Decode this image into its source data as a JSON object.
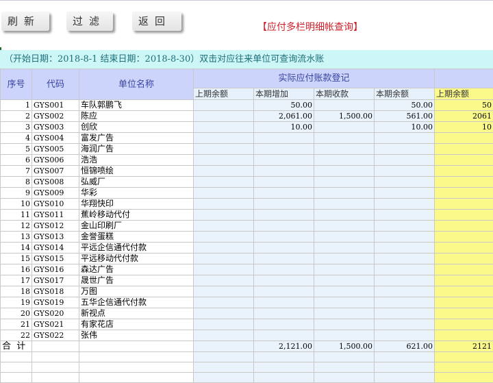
{
  "toolbar": {
    "refresh": "刷新",
    "filter": "过滤",
    "back": "返回"
  },
  "page_title": "【应付多栏明细帐查询】",
  "info_bar": "（开始日期：2018-8-1  结束日期：2018-8-30）双击对应往来单位可查询流水账",
  "headers": {
    "seq": "序号",
    "code": "代码",
    "name": "单位名称",
    "group": "实际应付账款登记",
    "prev_balance": "上期余额",
    "increase": "本期增加",
    "received": "本期收款",
    "cur_balance": "本期余额",
    "prev_balance2": "上期余额"
  },
  "rows": [
    {
      "seq": "1",
      "code": "GYS001",
      "name": "车队郭鹏飞",
      "prev": "",
      "inc": "50.00",
      "rec": "",
      "bal": "50.00",
      "prev2": "50"
    },
    {
      "seq": "2",
      "code": "GYS002",
      "name": "陈应",
      "prev": "",
      "inc": "2,061.00",
      "rec": "1,500.00",
      "bal": "561.00",
      "prev2": "2061"
    },
    {
      "seq": "3",
      "code": "GYS003",
      "name": "创欣",
      "prev": "",
      "inc": "10.00",
      "rec": "",
      "bal": "10.00",
      "prev2": "10"
    },
    {
      "seq": "4",
      "code": "GYS004",
      "name": "富发广告",
      "prev": "",
      "inc": "",
      "rec": "",
      "bal": "",
      "prev2": ""
    },
    {
      "seq": "5",
      "code": "GYS005",
      "name": "海润广告",
      "prev": "",
      "inc": "",
      "rec": "",
      "bal": "",
      "prev2": ""
    },
    {
      "seq": "6",
      "code": "GYS006",
      "name": "浩浩",
      "prev": "",
      "inc": "",
      "rec": "",
      "bal": "",
      "prev2": ""
    },
    {
      "seq": "7",
      "code": "GYS007",
      "name": "恒锦喷绘",
      "prev": "",
      "inc": "",
      "rec": "",
      "bal": "",
      "prev2": ""
    },
    {
      "seq": "8",
      "code": "GYS008",
      "name": "弘威厂",
      "prev": "",
      "inc": "",
      "rec": "",
      "bal": "",
      "prev2": ""
    },
    {
      "seq": "9",
      "code": "GYS009",
      "name": "华彩",
      "prev": "",
      "inc": "",
      "rec": "",
      "bal": "",
      "prev2": ""
    },
    {
      "seq": "10",
      "code": "GYS010",
      "name": "华翔快印",
      "prev": "",
      "inc": "",
      "rec": "",
      "bal": "",
      "prev2": ""
    },
    {
      "seq": "11",
      "code": "GYS011",
      "name": "蕉岭移动代付",
      "prev": "",
      "inc": "",
      "rec": "",
      "bal": "",
      "prev2": ""
    },
    {
      "seq": "12",
      "code": "GYS012",
      "name": "金山印刷厂",
      "prev": "",
      "inc": "",
      "rec": "",
      "bal": "",
      "prev2": ""
    },
    {
      "seq": "13",
      "code": "GYS013",
      "name": "金誉蛋糕",
      "prev": "",
      "inc": "",
      "rec": "",
      "bal": "",
      "prev2": ""
    },
    {
      "seq": "14",
      "code": "GYS014",
      "name": "平远企信通代付款",
      "prev": "",
      "inc": "",
      "rec": "",
      "bal": "",
      "prev2": ""
    },
    {
      "seq": "15",
      "code": "GYS015",
      "name": "平远移动代付款",
      "prev": "",
      "inc": "",
      "rec": "",
      "bal": "",
      "prev2": ""
    },
    {
      "seq": "16",
      "code": "GYS016",
      "name": "森达广告",
      "prev": "",
      "inc": "",
      "rec": "",
      "bal": "",
      "prev2": ""
    },
    {
      "seq": "17",
      "code": "GYS017",
      "name": "晟世广告",
      "prev": "",
      "inc": "",
      "rec": "",
      "bal": "",
      "prev2": ""
    },
    {
      "seq": "18",
      "code": "GYS018",
      "name": "万图",
      "prev": "",
      "inc": "",
      "rec": "",
      "bal": "",
      "prev2": ""
    },
    {
      "seq": "19",
      "code": "GYS019",
      "name": "五华企信通代付款",
      "prev": "",
      "inc": "",
      "rec": "",
      "bal": "",
      "prev2": ""
    },
    {
      "seq": "20",
      "code": "GYS020",
      "name": "新视点",
      "prev": "",
      "inc": "",
      "rec": "",
      "bal": "",
      "prev2": ""
    },
    {
      "seq": "21",
      "code": "GYS021",
      "name": "有家花店",
      "prev": "",
      "inc": "",
      "rec": "",
      "bal": "",
      "prev2": ""
    },
    {
      "seq": "22",
      "code": "GYS022",
      "name": "张伟",
      "prev": "",
      "inc": "",
      "rec": "",
      "bal": "",
      "prev2": ""
    }
  ],
  "total": {
    "label": "合  计",
    "prev": "",
    "inc": "2,121.00",
    "rec": "1,500.00",
    "bal": "621.00",
    "prev2": "2121"
  },
  "colors": {
    "title": "#d0202a",
    "header_bg": "#ccd4fb",
    "info_bg": "#cdf7f7",
    "highlight": "#fbf98a",
    "amount_bg": "#eaf3fc"
  }
}
